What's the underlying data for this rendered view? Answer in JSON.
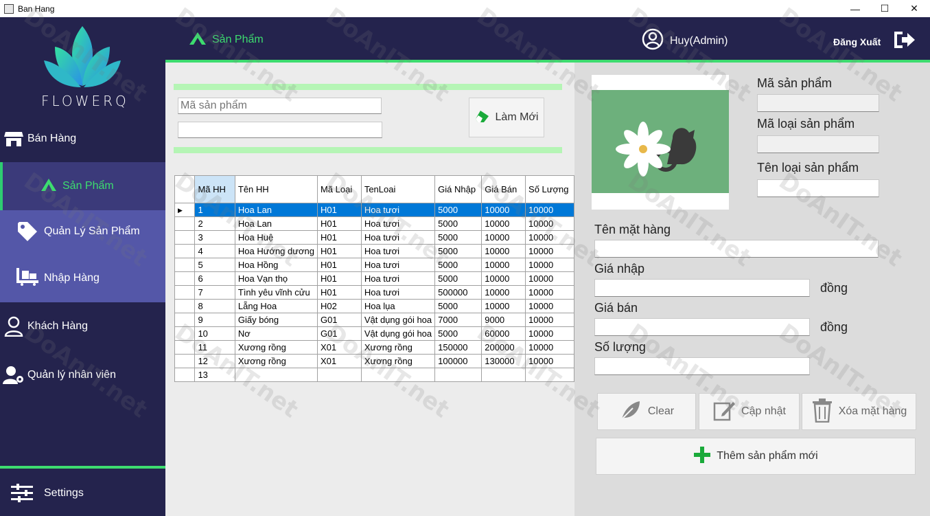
{
  "window": {
    "title": "Ban Hang",
    "minimize": "—",
    "maximize": "☐",
    "close": "✕"
  },
  "sidebar": {
    "logo_text": "FLOWERQ",
    "items": [
      {
        "label": "Bán Hàng"
      },
      {
        "label": "Sản Phẩm"
      },
      {
        "label": "Quản Lý Sản Phẩm"
      },
      {
        "label": "Nhập Hàng"
      },
      {
        "label": "Khách Hàng"
      },
      {
        "label": "Quản lý nhân viên"
      }
    ],
    "settings_label": "Settings"
  },
  "header": {
    "section_title": "Sản Phẩm",
    "user": "Huy(Admin)",
    "logout": "Đăng Xuất"
  },
  "search": {
    "product_code_placeholder": "Mã sản phẩm",
    "refresh_button": "Làm Mới"
  },
  "table": {
    "columns": [
      "Mã HH",
      "Tên HH",
      "Mã Loại",
      "TenLoai",
      "Giá Nhập",
      "Giá Bán",
      "Số Lượng"
    ],
    "rows": [
      [
        "1",
        "Hoa Lan",
        "H01",
        "Hoa tươi",
        "5000",
        "10000",
        "10000"
      ],
      [
        "2",
        "Hoa Lan",
        "H01",
        "Hoa tươi",
        "5000",
        "10000",
        "10000"
      ],
      [
        "3",
        "Hoa Huệ",
        "H01",
        "Hoa tươi",
        "5000",
        "10000",
        "10000"
      ],
      [
        "4",
        "Hoa Hướng dương",
        "H01",
        "Hoa tươi",
        "5000",
        "10000",
        "10000"
      ],
      [
        "5",
        "Hoa Hồng",
        "H01",
        "Hoa tươi",
        "5000",
        "10000",
        "10000"
      ],
      [
        "6",
        "Hoa Vạn thọ",
        "H01",
        "Hoa tươi",
        "5000",
        "10000",
        "10000"
      ],
      [
        "7",
        "Tình yêu vĩnh cửu",
        "H01",
        "Hoa tươi",
        "500000",
        "10000",
        "10000"
      ],
      [
        "8",
        "Lẵng Hoa",
        "H02",
        "Hoa lụa",
        "5000",
        "10000",
        "10000"
      ],
      [
        "9",
        "Giấy bóng",
        "G01",
        "Vật dụng gói hoa",
        "7000",
        "9000",
        "10000"
      ],
      [
        "10",
        "Nơ",
        "G01",
        "Vật dụng gói hoa",
        "5000",
        "60000",
        "10000"
      ],
      [
        "11",
        "Xương rồng",
        "X01",
        "Xương rồng",
        "150000",
        "200000",
        "10000"
      ],
      [
        "12",
        "Xương rồng",
        "X01",
        "Xương rồng",
        "100000",
        "130000",
        "10000"
      ],
      [
        "13",
        "",
        "",
        "",
        "",
        "",
        ""
      ]
    ],
    "selected_row": 0
  },
  "form": {
    "product_code_label": "Mã sản phẩm",
    "category_code_label": "Mã loại sản phẩm",
    "category_name_label": "Tên loại sản phẩm",
    "product_name_label": "Tên mặt hàng",
    "import_price_label": "Giá nhập",
    "sale_price_label": "Giá bán",
    "quantity_label": "Số lượng",
    "currency_unit": "đồng"
  },
  "actions": {
    "clear": "Clear",
    "update": "Cập nhật",
    "delete": "Xóa mặt hàng",
    "add_new": "Thêm sản phẩm mới"
  },
  "colors": {
    "sidebar_bg": "#24234d",
    "accent_green": "#3ddc6f",
    "nav_selected_bg": "#3b3a7a",
    "nav_sub_bg": "#5457a8",
    "grid_selection": "#0078d7"
  },
  "watermark": "DoAnIT.net"
}
